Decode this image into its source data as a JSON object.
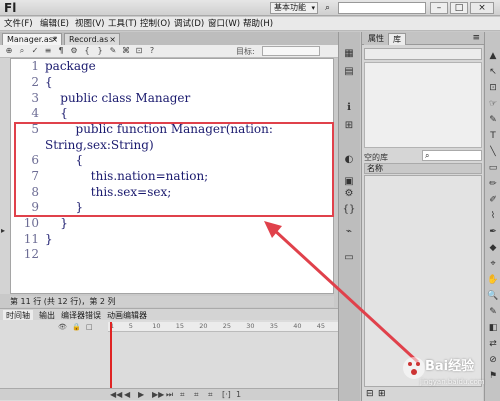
{
  "title_bar": {
    "app_logo": "Fl",
    "workspace_label": "基本功能",
    "workspace_arrow": "▾",
    "minimize": "–",
    "restore": "□",
    "close": "×"
  },
  "menu": [
    "文件(F)",
    "编辑(E)",
    "视图(V)",
    "工具(T)",
    "控制(O)",
    "调试(D)",
    "窗口(W)",
    "帮助(H)"
  ],
  "tabs": [
    {
      "label": "Manager.as*",
      "close": "×"
    },
    {
      "label": "Record.as",
      "close": "×"
    }
  ],
  "code_toolbar": {
    "icons": [
      "insert-icon",
      "find-icon",
      "check-syntax-icon",
      "auto-format-icon",
      "code-hint-icon",
      "debug-icon",
      "collapse-icon",
      "expand-icon",
      "comment-icon",
      "uncomment-icon",
      "toggle-icon",
      "help-icon"
    ],
    "icon_glyphs": [
      "⊕",
      "⌕",
      "✓",
      "≡",
      "¶",
      "⚙",
      "{",
      "}",
      "✎",
      "⌘",
      "⊡",
      "?"
    ],
    "target_label": "目标:"
  },
  "editor": {
    "line_numbers": [
      "1",
      "2",
      "3",
      "4",
      "5",
      "6",
      "7",
      "8",
      "9",
      "10",
      "11",
      "12"
    ],
    "lines": [
      "package",
      "{",
      "    public class Manager",
      "    {",
      "        public function Manager(nation:",
      "String,sex:String)",
      "        {",
      "            this.nation=nation;",
      "            this.sex=sex;",
      "        }",
      "    }",
      "}"
    ],
    "highlight_color": "#e0414b",
    "code_color": "#1a1a6e",
    "line_number_color": "#6d6d95",
    "left_rail_arrow": "▸"
  },
  "status": "第 11 行 (共 12 行)，第 2 列",
  "timeline": {
    "tabs": [
      "时间轴",
      "输出",
      "编译器错误",
      "动画编辑器"
    ],
    "ruler_ticks": [
      "1",
      "5",
      "10",
      "15",
      "20",
      "25",
      "30",
      "35",
      "40",
      "45"
    ],
    "layer_icons": [
      "👁",
      "🔒",
      "□"
    ],
    "controls": [
      "◀◀",
      "◀",
      "▶",
      "▶▶",
      "⏭",
      "⌗",
      "⌗",
      "⌗",
      "[·]",
      "1"
    ],
    "playhead_color": "#e02424"
  },
  "panel_strip": {
    "icons": [
      "swatch-icon",
      "align-icon",
      "info-icon",
      "transform-icon",
      "color-icon",
      "library-icon",
      "components-icon",
      "code-snippets-icon",
      "motion-presets-icon",
      "output-icon"
    ],
    "glyphs": [
      "▦",
      "▤",
      "ℹ",
      "⊞",
      "◐",
      "▣",
      "⚙",
      "{}",
      "⌁",
      "▭"
    ]
  },
  "right_panel": {
    "tabs": [
      "属性",
      "库"
    ],
    "library_count": "空的库",
    "search_icon": "⌕",
    "column_header": "名称",
    "panel_menu": "≡",
    "pin_icon": "⊞",
    "new_icon": "⊟"
  },
  "tools": {
    "glyphs": [
      "▲",
      "↖",
      "⊡",
      "☞",
      "✎",
      "T",
      "╲",
      "▭",
      "✏",
      "✐",
      "⌇",
      "✒",
      "◆",
      "⌖",
      "✋",
      "🔍",
      "✎",
      "◧",
      "⇄",
      "⊘",
      "⚑"
    ],
    "names": [
      "selection-tool-icon",
      "subselection-tool-icon",
      "free-transform-icon",
      "lasso-icon",
      "pen-icon",
      "text-tool-icon",
      "line-tool-icon",
      "rectangle-tool-icon",
      "pencil-icon",
      "brush-icon",
      "deco-icon",
      "bone-icon",
      "paint-bucket-icon",
      "eyedropper-icon",
      "hand-tool-icon",
      "zoom-tool-icon",
      "stroke-color-icon",
      "fill-color-icon",
      "swap-colors-icon",
      "no-color-icon",
      "snap-icon"
    ]
  },
  "watermark": {
    "logo": "Bai",
    "brand": "经验",
    "url": "jingyan.baidu.com"
  }
}
